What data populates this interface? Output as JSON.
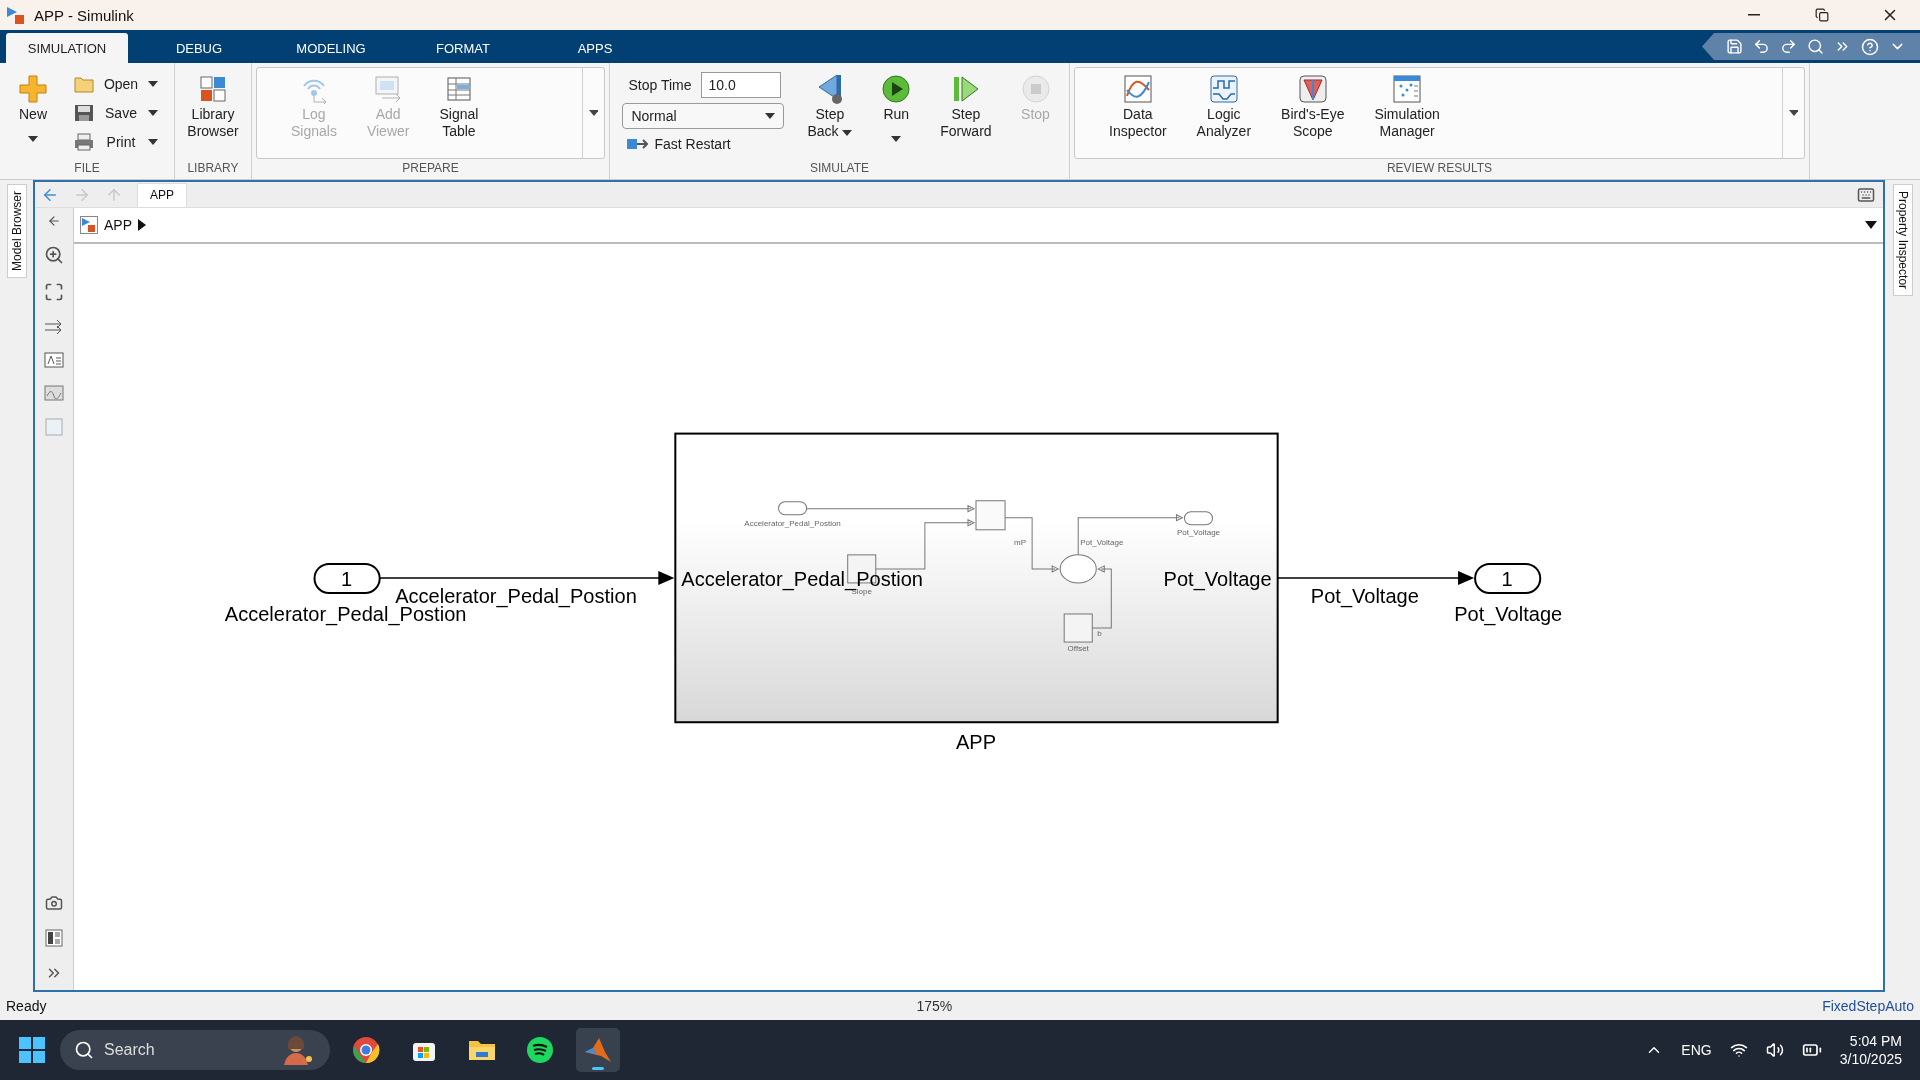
{
  "window": {
    "title": "APP - Simulink"
  },
  "ribbon_tabs": [
    {
      "label": "SIMULATION",
      "selected": true
    },
    {
      "label": "DEBUG",
      "selected": false
    },
    {
      "label": "MODELING",
      "selected": false
    },
    {
      "label": "FORMAT",
      "selected": false
    },
    {
      "label": "APPS",
      "selected": false
    }
  ],
  "ribbon_sections": [
    {
      "title": "FILE",
      "gallery": false,
      "items": [
        {
          "kind": "large",
          "label": "New",
          "dropdown": true,
          "disabled": false
        },
        {
          "kind": "small",
          "label": "Open",
          "dropdown": true,
          "disabled": false
        },
        {
          "kind": "small",
          "label": "Save",
          "dropdown": true,
          "disabled": false
        },
        {
          "kind": "small",
          "label": "Print",
          "dropdown": true,
          "disabled": false
        }
      ]
    },
    {
      "title": "LIBRARY",
      "gallery": false,
      "items": [
        {
          "kind": "large",
          "label": "Library\nBrowser",
          "dropdown": false,
          "disabled": false
        }
      ]
    },
    {
      "title": "PREPARE",
      "gallery": true,
      "items": [
        {
          "kind": "large",
          "label": "Log\nSignals",
          "dropdown": false,
          "disabled": true
        },
        {
          "kind": "large",
          "label": "Add\nViewer",
          "dropdown": false,
          "disabled": true
        },
        {
          "kind": "large",
          "label": "Signal\nTable",
          "dropdown": false,
          "disabled": false
        }
      ]
    },
    {
      "title": "SIMULATE",
      "gallery": false,
      "items": [
        {
          "kind": "field",
          "label": "Stop Time",
          "value": "10.0"
        },
        {
          "kind": "select",
          "value": "Normal"
        },
        {
          "kind": "small",
          "label": "Fast Restart",
          "dropdown": false,
          "disabled": false
        },
        {
          "kind": "large",
          "label": "Step\nBack",
          "dropdown": true,
          "disabled": false
        },
        {
          "kind": "large",
          "label": "Run",
          "dropdown": true,
          "disabled": false
        },
        {
          "kind": "large",
          "label": "Step\nForward",
          "dropdown": false,
          "disabled": false
        },
        {
          "kind": "large",
          "label": "Stop",
          "dropdown": false,
          "disabled": true
        }
      ]
    },
    {
      "title": "REVIEW RESULTS",
      "gallery": true,
      "items": [
        {
          "kind": "large",
          "label": "Data\nInspector",
          "dropdown": false,
          "disabled": false
        },
        {
          "kind": "large",
          "label": "Logic\nAnalyzer",
          "dropdown": false,
          "disabled": false
        },
        {
          "kind": "large",
          "label": "Bird's-Eye\nScope",
          "dropdown": false,
          "disabled": false
        },
        {
          "kind": "large",
          "label": "Simulation\nManager",
          "dropdown": false,
          "disabled": false
        }
      ]
    }
  ],
  "side_tabs": {
    "left": "Model Browser",
    "right": "Property Inspector"
  },
  "editor": {
    "tab": "APP",
    "breadcrumb": "APP"
  },
  "diagram": {
    "inport": {
      "number": "1",
      "name": "Accelerator_Pedal_Postion"
    },
    "input_signal": "Accelerator_Pedal_Postion",
    "subsystem": {
      "name": "APP",
      "in_port_label": "Accelerator_Pedal_Postion",
      "out_port_label": "Pot_Voltage",
      "inner": {
        "inport_name": "Accelerator_Pedal_Postion",
        "slope_name": "Slope",
        "product_signal": "mP",
        "sum_signal": "Pot_Voltage",
        "outport_name": "Pot_Voltage",
        "offset_name": "Offset",
        "offset_signal": "b"
      }
    },
    "output_signal": "Pot_Voltage",
    "outport": {
      "number": "1",
      "name": "Pot_Voltage"
    }
  },
  "status_bar": {
    "status": "Ready",
    "zoom": "175%",
    "solver": "FixedStepAuto"
  },
  "taskbar": {
    "search_placeholder": "Search",
    "language": "ENG",
    "time": "5:04 PM",
    "date": "3/10/2025"
  }
}
